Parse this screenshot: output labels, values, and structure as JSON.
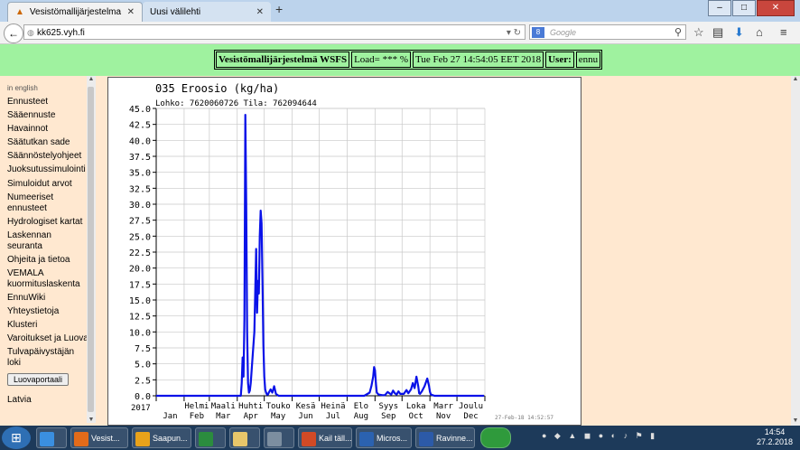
{
  "browser": {
    "tabs": [
      {
        "label": "Vesistömallijärjestelma",
        "active": true
      },
      {
        "label": "Uusi välilehti",
        "active": false
      }
    ],
    "url": "kk625.vyh.fi",
    "search_placeholder": "Google"
  },
  "status": {
    "system": "Vesistömallijärjestelmä WSFS",
    "load": "Load= *** %",
    "datetime": "Tue Feb 27 14:54:05 EET 2018",
    "user_label": "User:",
    "user": "ennu"
  },
  "sidebar": {
    "lang": "in english",
    "items": [
      "Ennusteet",
      "Sääennuste",
      "Havainnot",
      "Säätutkan sade",
      "Säännöstelyohjeet",
      "Juoksutussimulointi",
      "Simuloidut arvot",
      "Numeeriset ennusteet",
      "Hydrologiset kartat",
      "Laskennan seuranta",
      "Ohjeita ja tietoa",
      "VEMALA kuormituslaskenta",
      "EnnuWiki",
      "Yhteystietoja",
      "Klusteri",
      "Varoitukset ja Luova",
      "Tulvapäivystäjän loki"
    ],
    "portal_button": "Luovaportaali",
    "cut_item": "Latvia"
  },
  "chart_data": {
    "type": "line",
    "title": "035 Eroosio (kg/ha)",
    "subtitle": "Lohko: 7620060726 Tila: 762094644",
    "year_label": "2017",
    "ylim": [
      0,
      45
    ],
    "yticks": [
      "45.0",
      "42.5",
      "40.0",
      "37.5",
      "35.0",
      "32.5",
      "30.0",
      "27.5",
      "25.0",
      "22.5",
      "20.0",
      "17.5",
      "15.0",
      "12.5",
      "10.0",
      "7.5",
      "5.0",
      "2.5",
      "0.0"
    ],
    "months_fi": [
      "",
      "Helmi",
      "Maali",
      "Huhti",
      "Touko",
      "Kesä",
      "Heinä",
      "Elo",
      "Syys",
      "Loka",
      "Marr",
      "Joulu"
    ],
    "months_en": [
      "Jan",
      "Feb",
      "Mar",
      "Apr",
      "May",
      "Jun",
      "Jul",
      "Aug",
      "Sep",
      "Oct",
      "Nov",
      "Dec"
    ],
    "footer": "27-Feb-18 14:52:57",
    "x_day": [
      1,
      95,
      96,
      97,
      98,
      99,
      100,
      101,
      102,
      103,
      104,
      105,
      106,
      107,
      110,
      112,
      113,
      114,
      115,
      116,
      117,
      118,
      119,
      120,
      121,
      122,
      123,
      124,
      125,
      126,
      128,
      130,
      132,
      134,
      136,
      137,
      138,
      140,
      145,
      150,
      232,
      238,
      240,
      242,
      243,
      244,
      245,
      246,
      248,
      252,
      255,
      258,
      262,
      264,
      266,
      268,
      270,
      272,
      276,
      279,
      281,
      284,
      286,
      288,
      290,
      292,
      293,
      294,
      296,
      299,
      302,
      304,
      305,
      306,
      308,
      310,
      365
    ],
    "y": [
      0,
      0,
      2,
      6,
      3,
      12,
      44,
      30,
      10,
      2,
      0.5,
      0.8,
      2,
      4,
      10,
      23,
      13,
      18,
      16,
      25,
      29,
      27,
      18,
      8,
      3,
      1,
      0.5,
      0.2,
      0.2,
      0.5,
      1,
      0.5,
      1.5,
      0.3,
      0.1,
      0,
      0,
      0,
      0,
      0,
      0,
      0.5,
      1.5,
      3,
      4.5,
      4,
      2,
      0.5,
      0.2,
      0.1,
      0.1,
      0.6,
      0.2,
      0.8,
      0.4,
      0.2,
      0.7,
      0.3,
      0.3,
      0.9,
      0.4,
      1,
      2,
      1.2,
      3,
      1.5,
      0.4,
      0.3,
      0.7,
      1.5,
      2.7,
      1.5,
      0.6,
      0.2,
      0.1,
      0,
      0
    ],
    "color": "#0a12e8"
  },
  "taskbar": {
    "items": [
      "Vesist...",
      "Saapun...",
      "",
      "",
      "",
      "Kail täll...",
      "Micros...",
      "Ravinne..."
    ],
    "time": "14:54",
    "date": "27.2.2018"
  }
}
